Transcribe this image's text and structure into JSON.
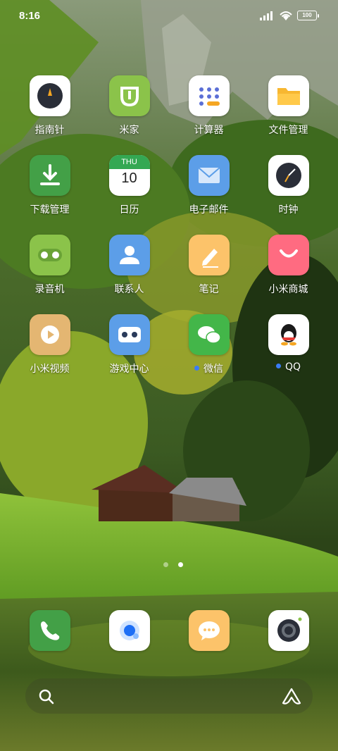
{
  "status_bar": {
    "time": "8:16",
    "battery": "100",
    "icons": [
      "signal-icon",
      "wifi-icon",
      "battery-icon"
    ]
  },
  "apps": [
    {
      "label": "指南针",
      "icon": "compass-icon"
    },
    {
      "label": "米家",
      "icon": "mijia-icon"
    },
    {
      "label": "计算器",
      "icon": "calculator-icon"
    },
    {
      "label": "文件管理",
      "icon": "folder-icon"
    },
    {
      "label": "下载管理",
      "icon": "download-icon"
    },
    {
      "label": "日历",
      "icon": "calendar-icon",
      "day": "THU",
      "date": "10"
    },
    {
      "label": "电子邮件",
      "icon": "mail-icon"
    },
    {
      "label": "时钟",
      "icon": "clock-icon"
    },
    {
      "label": "录音机",
      "icon": "recorder-icon"
    },
    {
      "label": "联系人",
      "icon": "contacts-icon"
    },
    {
      "label": "笔记",
      "icon": "notes-icon"
    },
    {
      "label": "小米商城",
      "icon": "mi-store-icon"
    },
    {
      "label": "小米视频",
      "icon": "video-icon"
    },
    {
      "label": "游戏中心",
      "icon": "game-center-icon"
    },
    {
      "label": "微信",
      "icon": "wechat-icon",
      "notification": true
    },
    {
      "label": "QQ",
      "icon": "qq-icon",
      "notification": true
    }
  ],
  "pager": {
    "pages": 2,
    "active": 2
  },
  "dock": [
    {
      "icon": "phone-icon"
    },
    {
      "icon": "browser-icon"
    },
    {
      "icon": "messages-icon"
    },
    {
      "icon": "camera-icon"
    }
  ],
  "search_bar": {
    "icons": [
      "search-icon",
      "app-vault-icon"
    ]
  }
}
